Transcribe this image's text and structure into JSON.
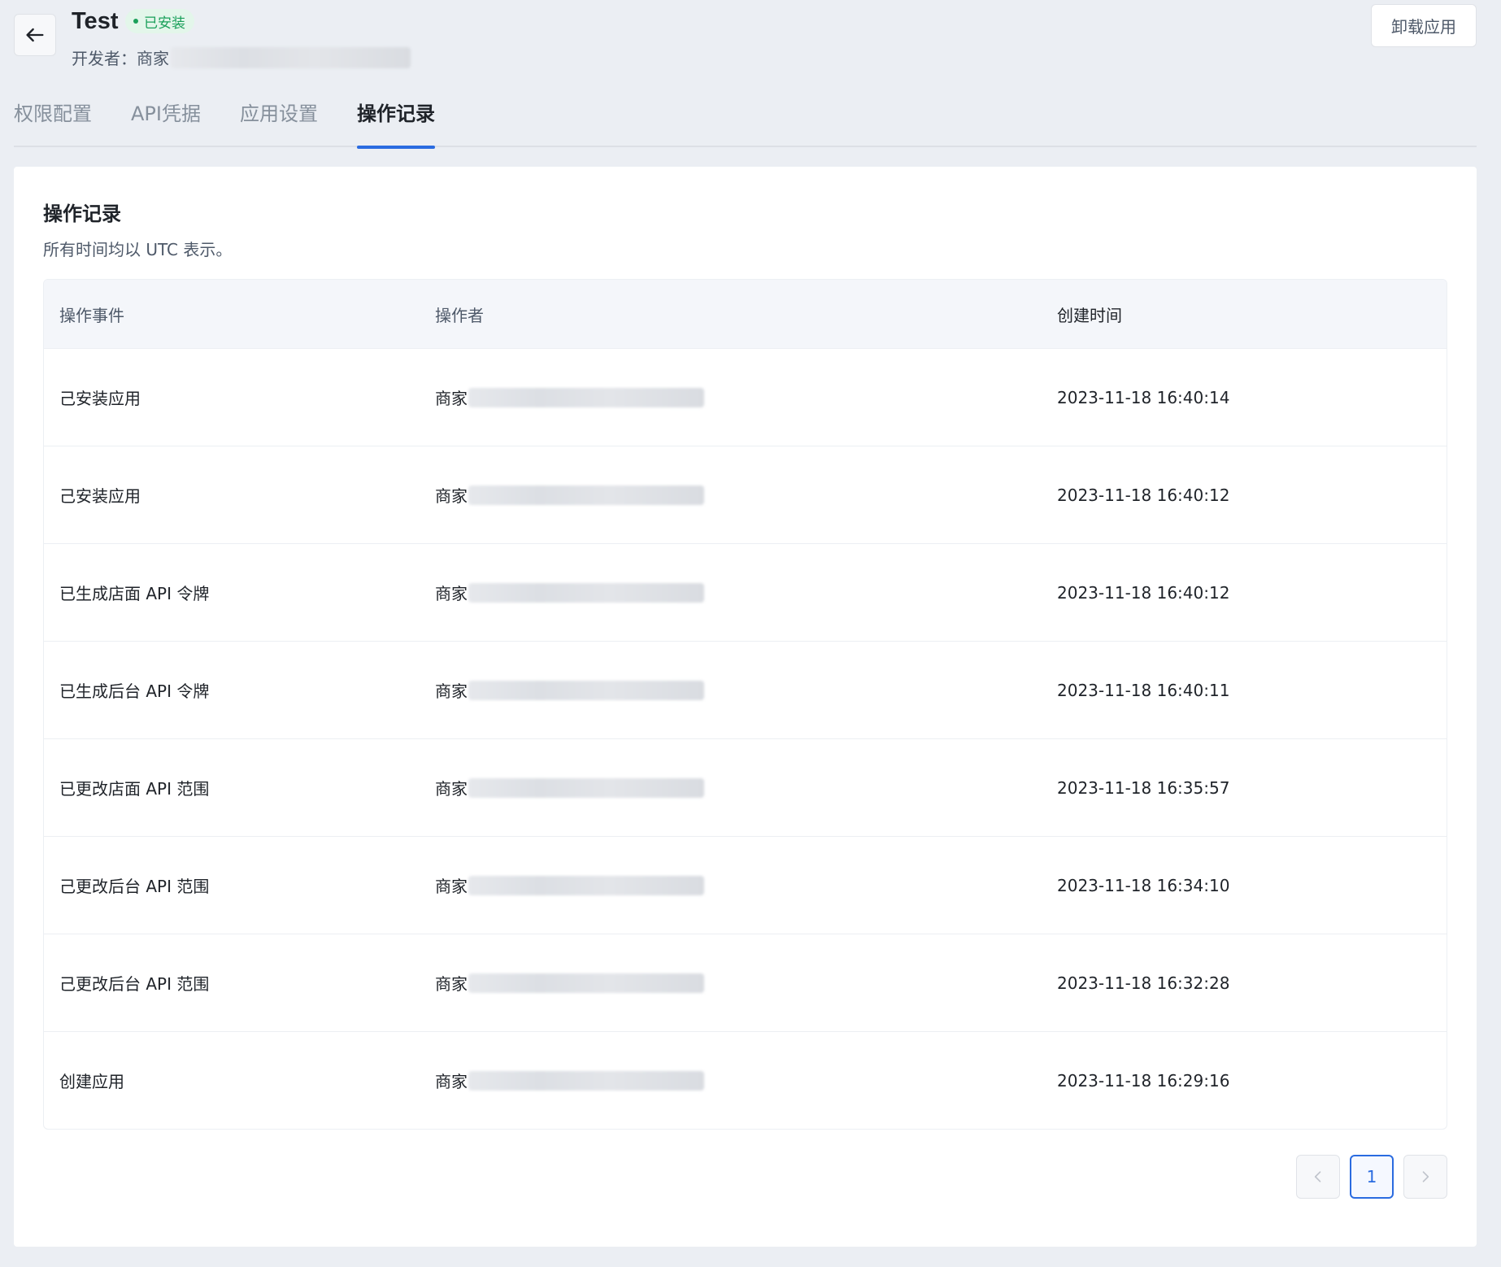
{
  "header": {
    "app_title": "Test",
    "status_badge": "已安装",
    "developer_label": "开发者：商家",
    "uninstall_label": "卸载应用"
  },
  "tabs": [
    {
      "label": "权限配置",
      "active": false
    },
    {
      "label": "API凭据",
      "active": false
    },
    {
      "label": "应用设置",
      "active": false
    },
    {
      "label": "操作记录",
      "active": true
    }
  ],
  "section": {
    "title": "操作记录",
    "subtitle": "所有时间均以 UTC 表示。"
  },
  "table": {
    "columns": [
      "操作事件",
      "操作者",
      "创建时间"
    ],
    "rows": [
      {
        "event": "己安装应用",
        "operator": "商家",
        "time": "2023-11-18 16:40:14"
      },
      {
        "event": "己安装应用",
        "operator": "商家",
        "time": "2023-11-18 16:40:12"
      },
      {
        "event": "已生成店面 API 令牌",
        "operator": "商家",
        "time": "2023-11-18 16:40:12"
      },
      {
        "event": "已生成后台 API 令牌",
        "operator": "商家",
        "time": "2023-11-18 16:40:11"
      },
      {
        "event": "已更改店面 API 范围",
        "operator": "商家",
        "time": "2023-11-18 16:35:57"
      },
      {
        "event": "己更改后台 API 范围",
        "operator": "商家",
        "time": "2023-11-18 16:34:10"
      },
      {
        "event": "己更改后台 API 范围",
        "operator": "商家",
        "time": "2023-11-18 16:32:28"
      },
      {
        "event": "创建应用",
        "operator": "商家",
        "time": "2023-11-18 16:29:16"
      }
    ]
  },
  "pagination": {
    "prev_icon": "chevron-left-icon",
    "current_page": "1",
    "next_icon": "chevron-right-icon"
  },
  "colors": {
    "accent": "#2a6be0",
    "badge_text": "#1aa05a",
    "badge_bg": "#e3f6ea",
    "page_bg": "#ebeef3"
  }
}
